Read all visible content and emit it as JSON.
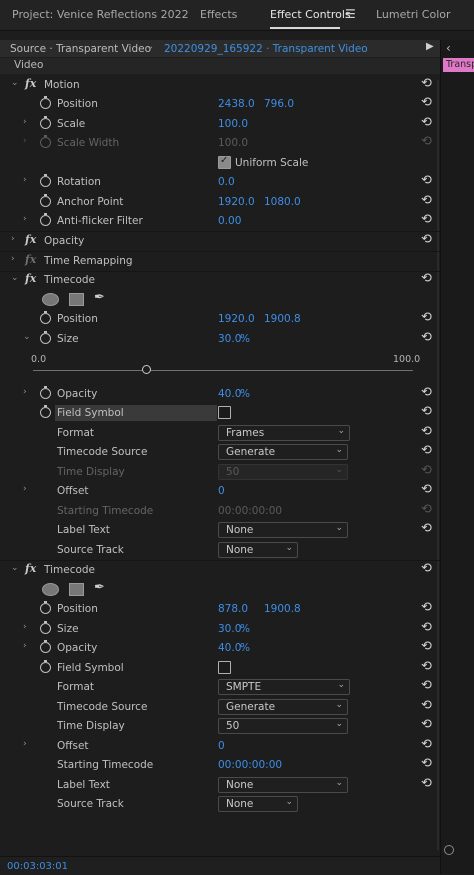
{
  "tabs": [
    "Project: Venice Reflections 2022",
    "Effects",
    "Effect Controls",
    "Lumetri Color"
  ],
  "tab_menu_icon": "hamburger-menu-icon",
  "source_bar": {
    "source": "Source · Transparent Video",
    "sequence": "20220929_165922 · Transparent Video"
  },
  "timeline_clip": "Transparent Video",
  "video_header": "Video",
  "motion": {
    "title": "Motion",
    "position_label": "Position",
    "position_x": "2438.0",
    "position_y": "796.0",
    "scale_label": "Scale",
    "scale_val": "100.0",
    "scale_width_label": "Scale Width",
    "scale_width_val": "100.0",
    "uniform_label": "Uniform Scale",
    "uniform_checked": true,
    "rotation_label": "Rotation",
    "rotation_val": "0.0",
    "anchor_label": "Anchor Point",
    "anchor_x": "1920.0",
    "anchor_y": "1080.0",
    "flicker_label": "Anti-flicker Filter",
    "flicker_val": "0.00"
  },
  "opacity_title": "Opacity",
  "time_remap_title": "Time Remapping",
  "tc1": {
    "title": "Timecode",
    "position_label": "Position",
    "position_x": "1920.0",
    "position_y": "1900.8",
    "size_label": "Size",
    "size_val": "30.0",
    "slider_min": "0.0",
    "slider_max": "100.0",
    "slider_value_fraction": 0.3,
    "opacity_label": "Opacity",
    "opacity_val": "40.0",
    "field_symbol_label": "Field Symbol",
    "field_symbol_checked": false,
    "format_label": "Format",
    "format_val": "Frames",
    "tc_source_label": "Timecode Source",
    "tc_source_val": "Generate",
    "time_display_label": "Time Display",
    "time_display_val": "50",
    "offset_label": "Offset",
    "offset_val": "0",
    "starting_tc_label": "Starting Timecode",
    "starting_tc_val": "00:00:00:00",
    "label_text_label": "Label Text",
    "label_text_val": "None",
    "source_track_label": "Source Track",
    "source_track_val": "None"
  },
  "tc2": {
    "title": "Timecode",
    "position_label": "Position",
    "position_x": "878.0",
    "position_y": "1900.8",
    "size_label": "Size",
    "size_val": "30.0",
    "opacity_label": "Opacity",
    "opacity_val": "40.0",
    "field_symbol_label": "Field Symbol",
    "field_symbol_checked": false,
    "format_label": "Format",
    "format_val": "SMPTE",
    "tc_source_label": "Timecode Source",
    "tc_source_val": "Generate",
    "time_display_label": "Time Display",
    "time_display_val": "50",
    "offset_label": "Offset",
    "offset_val": "0",
    "starting_tc_label": "Starting Timecode",
    "starting_tc_val": "00:00:00:00",
    "label_text_label": "Label Text",
    "label_text_val": "None",
    "source_track_label": "Source Track",
    "source_track_val": "None"
  },
  "percent_unit": "%",
  "reset_icon": "reset-icon",
  "timecode_footer": "00:03:03:01",
  "accent_color": "#3e8ee6",
  "clip_color": "#e078c8"
}
